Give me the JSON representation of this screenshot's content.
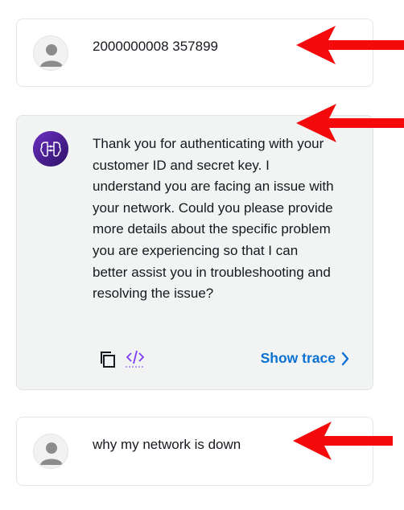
{
  "messages": [
    {
      "role": "user",
      "text": "2000000008 357899",
      "avatar_icon": "user-icon"
    },
    {
      "role": "assistant",
      "text": "Thank you for authenticating with your customer ID and secret key. I understand you are facing an issue with your network. Could you please provide more details about the specific problem you are experiencing so that I can better assist you in troubleshooting and resolving the issue?",
      "avatar_icon": "ai-brain-icon",
      "actions": {
        "copy_icon": "copy-icon",
        "code_icon": "code-icon",
        "show_trace_label": "Show trace"
      }
    },
    {
      "role": "user",
      "text": "why my network is down",
      "avatar_icon": "user-icon"
    }
  ],
  "annotations": {
    "arrow_color": "#f40a0a"
  },
  "colors": {
    "link": "#0972d3",
    "bot_bg": "#f2f3f3",
    "bot_avatar": "#4a1f8a"
  }
}
